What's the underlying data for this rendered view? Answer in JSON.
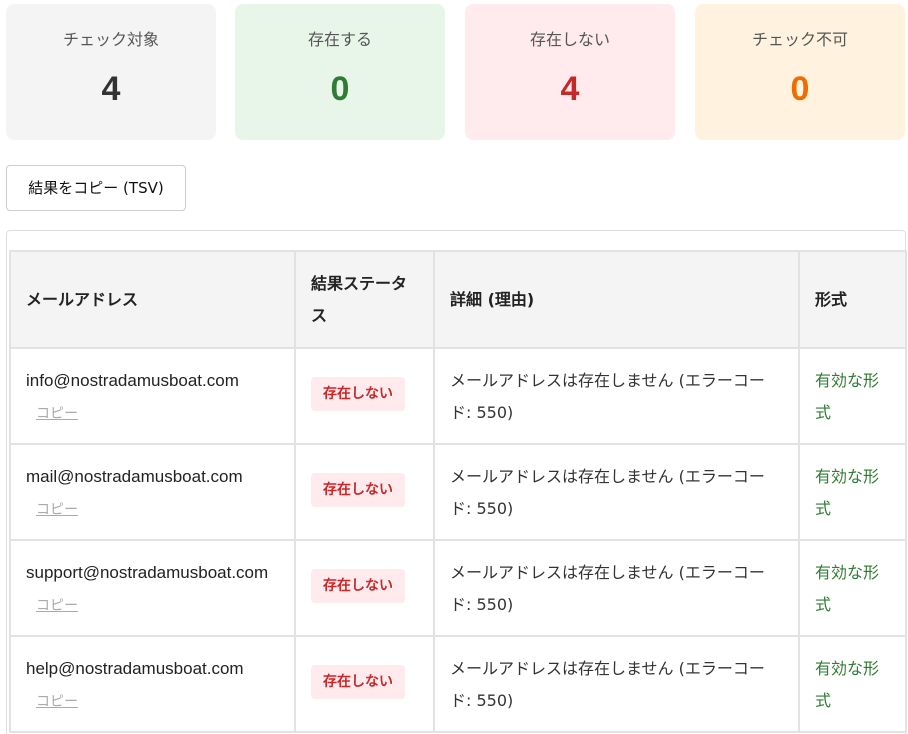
{
  "summary": {
    "total": {
      "label": "チェック対象",
      "value": "4",
      "color": "#333333"
    },
    "exists": {
      "label": "存在する",
      "value": "0",
      "color": "#2e7d32"
    },
    "not_exists": {
      "label": "存在しない",
      "value": "4",
      "color": "#c62828"
    },
    "unknown": {
      "label": "チェック不可",
      "value": "0",
      "color": "#ef6c00"
    }
  },
  "toolbar": {
    "copy_button_label": "結果をコピー (TSV)"
  },
  "table": {
    "headers": [
      "メールアドレス",
      "結果ステータス",
      "詳細 (理由)",
      "形式"
    ],
    "rows": [
      {
        "email": "info@nostradamusboat.com",
        "copy_label": "コピー",
        "status": "存在しない",
        "detail": "メールアドレスは存在しません (エラーコード: 550)",
        "format": "有効な形式"
      },
      {
        "email": "mail@nostradamusboat.com",
        "copy_label": "コピー",
        "status": "存在しない",
        "detail": "メールアドレスは存在しません (エラーコード: 550)",
        "format": "有効な形式"
      },
      {
        "email": "support@nostradamusboat.com",
        "copy_label": "コピー",
        "status": "存在しない",
        "detail": "メールアドレスは存在しません (エラーコード: 550)",
        "format": "有効な形式"
      },
      {
        "email": "help@nostradamusboat.com",
        "copy_label": "コピー",
        "status": "存在しない",
        "detail": "メールアドレスは存在しません (エラーコード: 550)",
        "format": "有効な形式"
      }
    ]
  }
}
